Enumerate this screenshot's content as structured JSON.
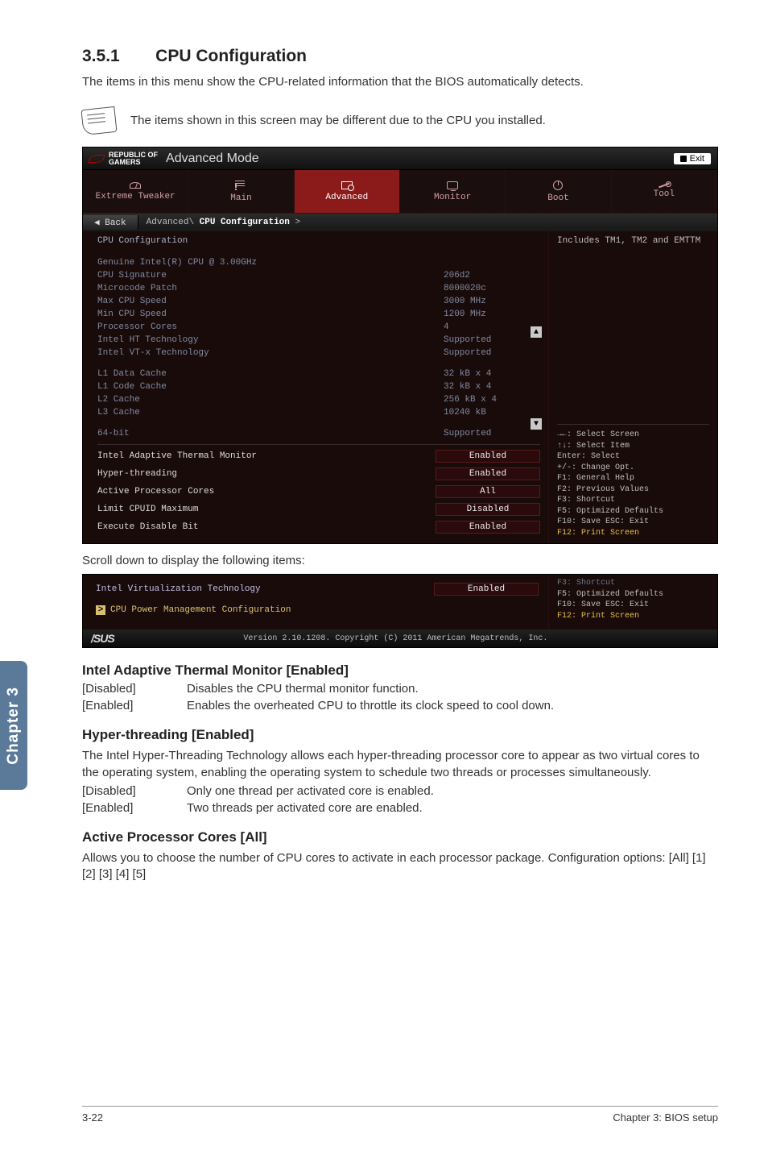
{
  "tab_label": "Chapter 3",
  "section": {
    "num": "3.5.1",
    "title": "CPU Configuration"
  },
  "intro": "The items in this menu show the CPU-related information that the BIOS automatically detects.",
  "note": "The items shown in this screen may be different due to the CPU you installed.",
  "bios": {
    "brand_top": "REPUBLIC OF",
    "brand_bottom": "GAMERS",
    "mode": "Advanced Mode",
    "exit": "Exit",
    "tabs": {
      "extreme": "Extreme Tweaker",
      "main": "Main",
      "advanced": "Advanced",
      "monitor": "Monitor",
      "boot": "Boot",
      "tool": "Tool"
    },
    "back": "Back",
    "breadcrumb_prefix": "Advanced\\ ",
    "breadcrumb_hl": "CPU Configuration",
    "breadcrumb_suffix": " >",
    "left": {
      "title": "CPU Configuration",
      "rows": [
        {
          "label": "Genuine Intel(R) CPU @ 3.00GHz",
          "val": ""
        },
        {
          "label": "CPU Signature",
          "val": "206d2"
        },
        {
          "label": "Microcode Patch",
          "val": "8000020c"
        },
        {
          "label": "Max CPU Speed",
          "val": "3000 MHz"
        },
        {
          "label": "Min CPU Speed",
          "val": "1200 MHz"
        },
        {
          "label": "Processor Cores",
          "val": "4"
        },
        {
          "label": "Intel HT Technology",
          "val": "Supported"
        },
        {
          "label": "Intel VT-x Technology",
          "val": "Supported"
        }
      ],
      "rows2": [
        {
          "label": "L1 Data Cache",
          "val": "32 kB x 4"
        },
        {
          "label": "L1 Code Cache",
          "val": "32 kB x 4"
        },
        {
          "label": "L2 Cache",
          "val": "256 kB x 4"
        },
        {
          "label": "L3 Cache",
          "val": "10240 kB"
        }
      ],
      "rows3": [
        {
          "label": "64-bit",
          "val": "Supported"
        }
      ],
      "settings": [
        {
          "label": "Intel Adaptive Thermal Monitor",
          "val": "Enabled"
        },
        {
          "label": "Hyper-threading",
          "val": "Enabled"
        },
        {
          "label": "Active Processor Cores",
          "val": "All"
        },
        {
          "label": "Limit CPUID Maximum",
          "val": "Disabled"
        },
        {
          "label": "Execute Disable Bit",
          "val": "Enabled"
        }
      ]
    },
    "right": {
      "help": "Includes TM1, TM2 and EMTTM",
      "keys": {
        "k1": "→←: Select Screen",
        "k2": "↑↓: Select Item",
        "k3": "Enter: Select",
        "k4": "+/-: Change Opt.",
        "k5": "F1: General Help",
        "k6": "F2: Previous Values",
        "k7": "F3: Shortcut",
        "k8": "F5: Optimized Defaults",
        "k9": "F10: Save  ESC: Exit",
        "k10": "F12: Print Screen"
      }
    }
  },
  "scroll_note": "Scroll down to display the following items:",
  "bios2": {
    "row1_label": "Intel Virtualization Technology",
    "row1_val": "Enabled",
    "row2_label": "CPU Power Management Configuration",
    "right": {
      "r0": "F3: Shortcut",
      "r1": "F5: Optimized Defaults",
      "r2": "F10: Save  ESC: Exit",
      "r3": "F12: Print Screen"
    },
    "footer": "Version 2.10.1208. Copyright (C) 2011 American Megatrends, Inc."
  },
  "sub1": {
    "title": "Intel Adaptive Thermal Monitor [Enabled]",
    "opts": [
      {
        "k": "[Disabled]",
        "v": "Disables the CPU thermal monitor function."
      },
      {
        "k": "[Enabled]",
        "v": "Enables the overheated CPU to throttle its clock speed to cool down."
      }
    ]
  },
  "sub2": {
    "title": "Hyper-threading [Enabled]",
    "desc": "The Intel Hyper-Threading Technology allows each hyper-threading processor core to appear as two virtual cores to the operating system, enabling the operating system to schedule two threads or processes simultaneously.",
    "opts": [
      {
        "k": "[Disabled]",
        "v": "Only one thread per activated core is enabled."
      },
      {
        "k": "[Enabled]",
        "v": "Two threads per activated core are enabled."
      }
    ]
  },
  "sub3": {
    "title": "Active Processor Cores [All]",
    "desc": "Allows you to choose the number of CPU cores to activate in each processor package. Configuration options: [All] [1] [2] [3] [4] [5]"
  },
  "footer": {
    "left": "3-22",
    "right": "Chapter 3: BIOS setup"
  }
}
